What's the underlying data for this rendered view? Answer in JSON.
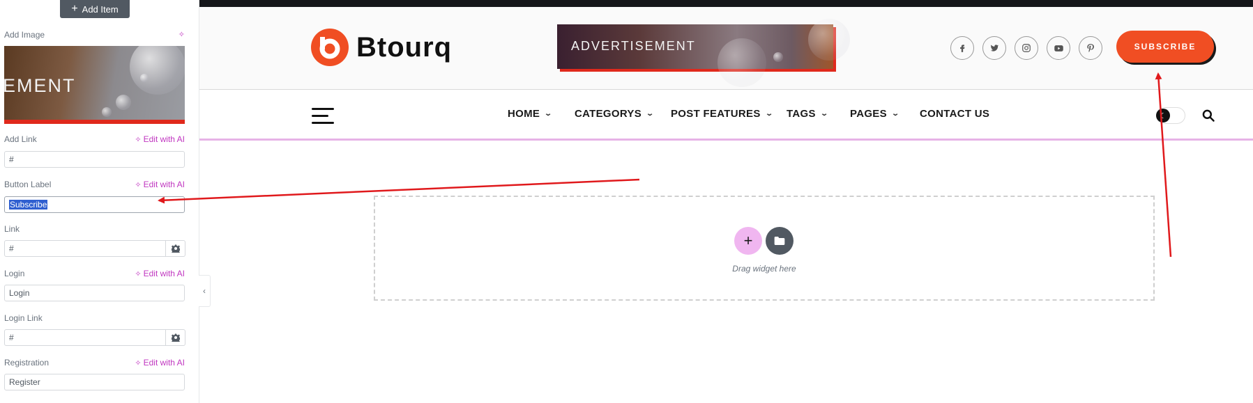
{
  "editor": {
    "add_item_label": "Add Item",
    "add_image_label": "Add Image",
    "image_preview_text": "EMENT",
    "add_link": {
      "label": "Add Link",
      "value": "#"
    },
    "edit_with_ai": "Edit with AI",
    "button_label": {
      "label": "Button Label",
      "value": "Subscribe"
    },
    "link": {
      "label": "Link",
      "value": "#"
    },
    "login": {
      "label": "Login",
      "value": "Login"
    },
    "login_link": {
      "label": "Login Link",
      "value": "#"
    },
    "registration": {
      "label": "Registration",
      "value": "Register"
    }
  },
  "site": {
    "logo_text": "Btourq",
    "advertisement": "ADVERTISEMENT",
    "social_icons": [
      "facebook-icon",
      "twitter-icon",
      "instagram-icon",
      "youtube-icon",
      "pinterest-icon"
    ],
    "subscribe_label": "SUBSCRIBE",
    "nav": [
      {
        "label": "HOME",
        "dropdown": true
      },
      {
        "label": "CATEGORYS",
        "dropdown": true
      },
      {
        "label": "POST FEATURES",
        "dropdown": true
      },
      {
        "label": "TAGS",
        "dropdown": true
      },
      {
        "label": "PAGES",
        "dropdown": true
      },
      {
        "label": "CONTACT US",
        "dropdown": false
      }
    ],
    "drop_zone_text": "Drag widget here"
  },
  "colors": {
    "brand": "#f04e23",
    "ai_accent": "#c036c0",
    "annotation": "#e0191c"
  }
}
